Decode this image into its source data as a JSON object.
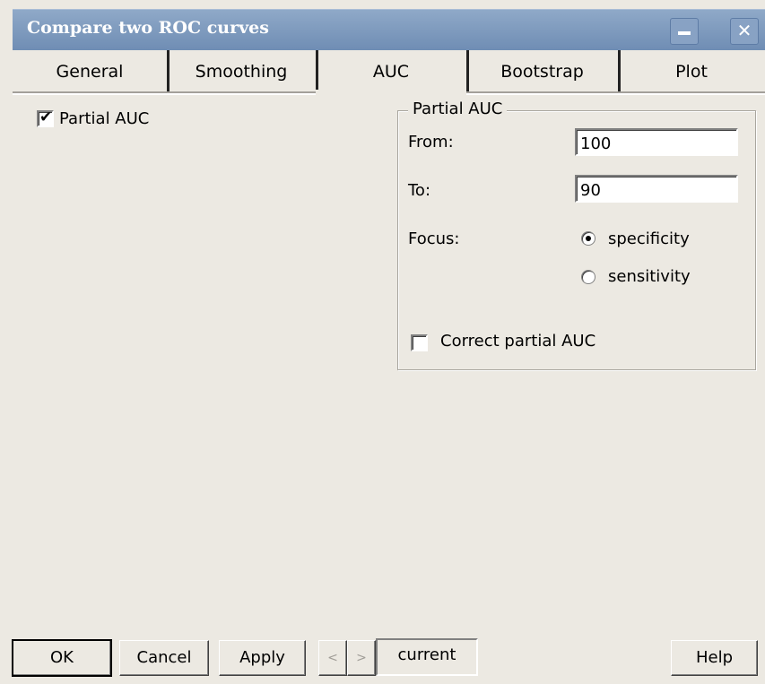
{
  "window": {
    "title": "Compare two ROC curves",
    "minimize_icon": "minimize-icon",
    "close_icon": "close-icon",
    "close_glyph": "✕"
  },
  "tabs": [
    {
      "label": "General",
      "active": false
    },
    {
      "label": "Smoothing",
      "active": false
    },
    {
      "label": "AUC",
      "active": true
    },
    {
      "label": "Bootstrap",
      "active": false
    },
    {
      "label": "Plot",
      "active": false
    }
  ],
  "auc_tab": {
    "partial_auc_checkbox": {
      "label": "Partial AUC",
      "checked": true,
      "mark": "✔"
    },
    "partial_auc_group": {
      "title": "Partial AUC",
      "from": {
        "label": "From:",
        "value": "100"
      },
      "to": {
        "label": "To:",
        "value": "90"
      },
      "focus": {
        "label": "Focus:",
        "options": [
          {
            "label": "specificity",
            "selected": true
          },
          {
            "label": "sensitivity",
            "selected": false
          }
        ]
      },
      "correct_checkbox": {
        "label": "Correct partial AUC",
        "checked": false
      }
    }
  },
  "footer": {
    "ok_label": "OK",
    "cancel_label": "Cancel",
    "apply_label": "Apply",
    "prev_glyph": "<",
    "next_glyph": ">",
    "current_label": "current",
    "help_label": "Help"
  },
  "colors": {
    "dialog_bg": "#ECE9E2",
    "titlebar": "#7F9CC0",
    "title_text": "#FFFFFF"
  }
}
